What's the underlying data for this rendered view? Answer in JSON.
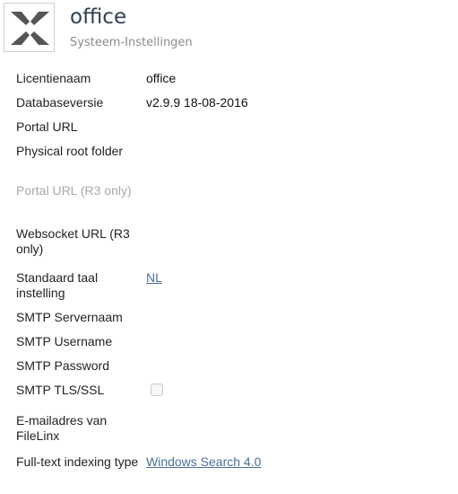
{
  "header": {
    "logo_icon": "filelinx-x-logo-icon",
    "title": "office",
    "subtitle": "Systeem-Instellingen"
  },
  "settings": {
    "rows": [
      {
        "label": "Licentienaam",
        "value": "office",
        "type": "text",
        "disabled": false
      },
      {
        "label": "Databaseversie",
        "value": "v2.9.9 18-08-2016",
        "type": "text",
        "disabled": false
      },
      {
        "label": "Portal URL",
        "value": "",
        "type": "text",
        "disabled": false
      },
      {
        "label": "Physical root folder",
        "value": "",
        "type": "text",
        "disabled": false
      },
      {
        "label": "Portal URL (R3 only)",
        "value": "",
        "type": "text",
        "disabled": true
      },
      {
        "label": "Websocket URL (R3 only)",
        "value": "",
        "type": "text",
        "disabled": false
      },
      {
        "label": "Standaard taal instelling",
        "value": "NL",
        "type": "link",
        "disabled": false
      },
      {
        "label": "SMTP Servernaam",
        "value": "",
        "type": "text",
        "disabled": false
      },
      {
        "label": "SMTP Username",
        "value": "",
        "type": "text",
        "disabled": false
      },
      {
        "label": "SMTP Password",
        "value": "",
        "type": "text",
        "disabled": false
      },
      {
        "label": "SMTP TLS/SSL",
        "checked": false,
        "type": "checkbox",
        "disabled": true
      },
      {
        "label": "E-mailadres van FileLinx",
        "value": "",
        "type": "text",
        "disabled": false
      },
      {
        "label": "Full-text indexing type",
        "value": "Windows Search 4.0",
        "type": "link",
        "disabled": false
      }
    ]
  }
}
